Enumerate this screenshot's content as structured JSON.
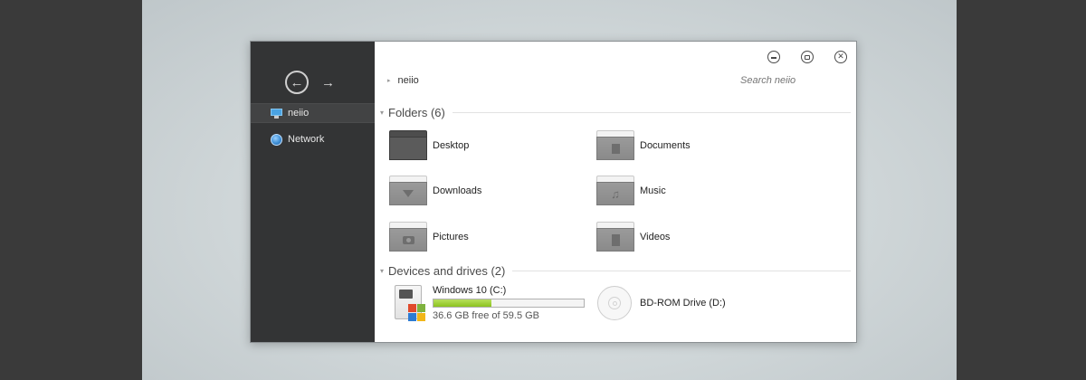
{
  "nav": {
    "back": "←",
    "forward": "→"
  },
  "sidebar": {
    "items": [
      {
        "label": "neiio",
        "icon": "computer-icon",
        "active": true
      },
      {
        "label": "Network",
        "icon": "network-globe-icon",
        "active": false
      }
    ]
  },
  "window_controls": {
    "minimize": "minimize-icon",
    "maximize": "maximize-icon",
    "close": "close-icon",
    "close_glyph": "✕"
  },
  "breadcrumb": {
    "arrow": "▸",
    "path": "neiio"
  },
  "search": {
    "placeholder": "Search neiio"
  },
  "folders_section": {
    "tri": "▾",
    "title": "Folders (6)",
    "items": [
      {
        "label": "Desktop",
        "icon": "desktop-folder-icon"
      },
      {
        "label": "Documents",
        "icon": "documents-folder-icon"
      },
      {
        "label": "Downloads",
        "icon": "downloads-folder-icon"
      },
      {
        "label": "Music",
        "icon": "music-folder-icon",
        "glyph": "♫"
      },
      {
        "label": "Pictures",
        "icon": "pictures-folder-icon"
      },
      {
        "label": "Videos",
        "icon": "videos-folder-icon"
      }
    ]
  },
  "devices_section": {
    "tri": "▾",
    "title": "Devices and drives (2)",
    "drives": [
      {
        "name": "Windows 10 (C:)",
        "free_text": "36.6 GB free of 59.5 GB",
        "used_fraction": 0.385,
        "icon": "hard-drive-icon",
        "bar_color": "#8cc21e"
      },
      {
        "name": "BD-ROM Drive (D:)",
        "icon": "disc-drive-icon"
      }
    ]
  },
  "colors": {
    "sidebar_bg": "#333435",
    "accent_green": "#8cc21e",
    "window_bg": "#ffffff"
  }
}
